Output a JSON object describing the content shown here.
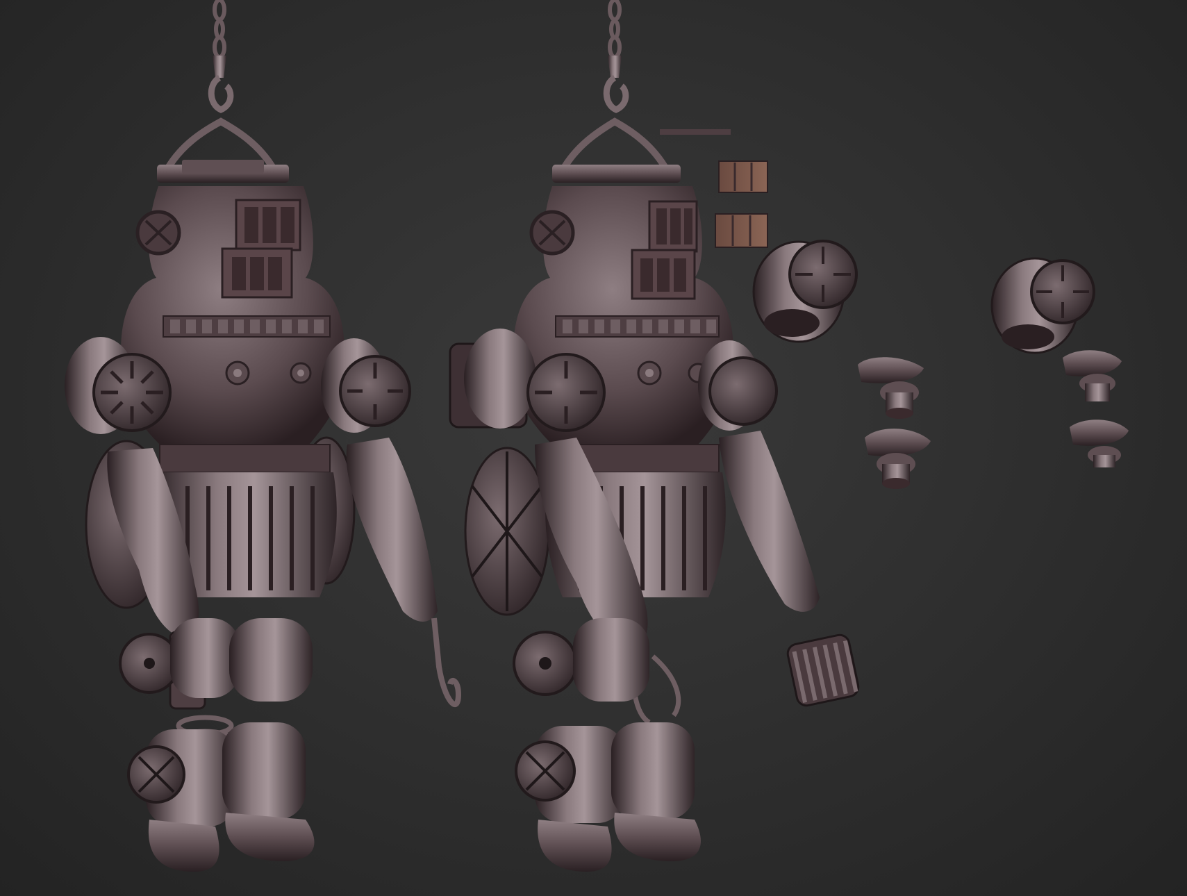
{
  "scene": {
    "background": "#2c2c2c",
    "material_base": "#5a4a4c",
    "material_highlight": "#b8a8ac",
    "material_shadow": "#1e1719",
    "models": [
      {
        "name": "diving-suit-figure-left",
        "left_tool": "claw-gripper",
        "right_tool": "hook",
        "backpack": false
      },
      {
        "name": "diving-suit-figure-right",
        "left_tool": "pincer-claw",
        "right_tool": "gatling-barrel",
        "backpack": true
      }
    ],
    "loose_parts": [
      "grille-panel-thin",
      "grille-panel-upper",
      "grille-panel-lower",
      "shoulder-cap-a",
      "connector-a-1",
      "connector-a-2",
      "shoulder-cap-b",
      "connector-b-1",
      "connector-b-2"
    ]
  }
}
